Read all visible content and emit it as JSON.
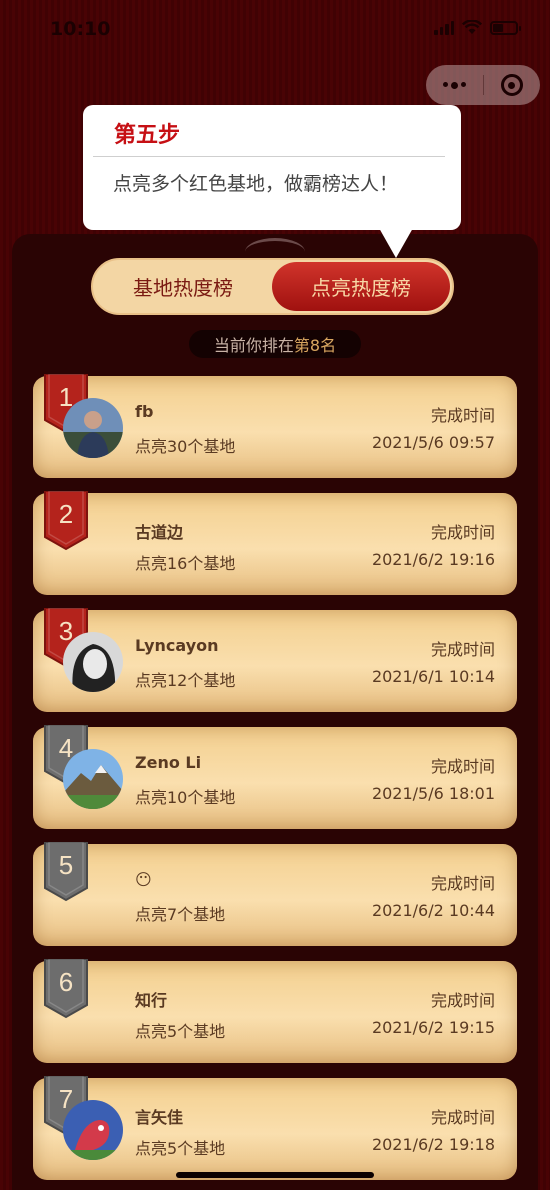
{
  "status": {
    "time": "10:10"
  },
  "tooltip": {
    "title": "第五步",
    "text": "点亮多个红色基地，做霸榜达人！"
  },
  "tabs": {
    "left": "基地热度榜",
    "right": "点亮热度榜",
    "active": "right"
  },
  "rank": {
    "prefix": "当前你排在",
    "highlight": "第8名"
  },
  "list": {
    "items": [
      {
        "rank": "1",
        "name": "fb",
        "count": "点亮30个基地",
        "time_label": "完成时间",
        "time": "2021/5/6 09:57",
        "badge": "red",
        "avatar": "person-photo"
      },
      {
        "rank": "2",
        "name": "古道边",
        "count": "点亮16个基地",
        "time_label": "完成时间",
        "time": "2021/6/2 19:16",
        "badge": "red",
        "avatar": "none"
      },
      {
        "rank": "3",
        "name": "Lyncayon",
        "count": "点亮12个基地",
        "time_label": "完成时间",
        "time": "2021/6/1 10:14",
        "badge": "red",
        "avatar": "bw-portrait"
      },
      {
        "rank": "4",
        "name": "Zeno Li",
        "count": "点亮10个基地",
        "time_label": "完成时间",
        "time": "2021/5/6 18:01",
        "badge": "gray",
        "avatar": "mountain-photo"
      },
      {
        "rank": "5",
        "name": "😶",
        "count": "点亮7个基地",
        "time_label": "完成时间",
        "time": "2021/6/2 10:44",
        "badge": "gray",
        "avatar": "none"
      },
      {
        "rank": "6",
        "name": "知行",
        "count": "点亮5个基地",
        "time_label": "完成时间",
        "time": "2021/6/2 19:15",
        "badge": "gray",
        "avatar": "none"
      },
      {
        "rank": "7",
        "name": "言矢佳",
        "count": "点亮5个基地",
        "time_label": "完成时间",
        "time": "2021/6/2 19:18",
        "badge": "gray",
        "avatar": "dino-drawing"
      }
    ]
  },
  "colors": {
    "accent": "#c60f14",
    "badge_red": "#b4231c",
    "badge_gray": "#6d6d6d",
    "card": "#f6d59a"
  }
}
